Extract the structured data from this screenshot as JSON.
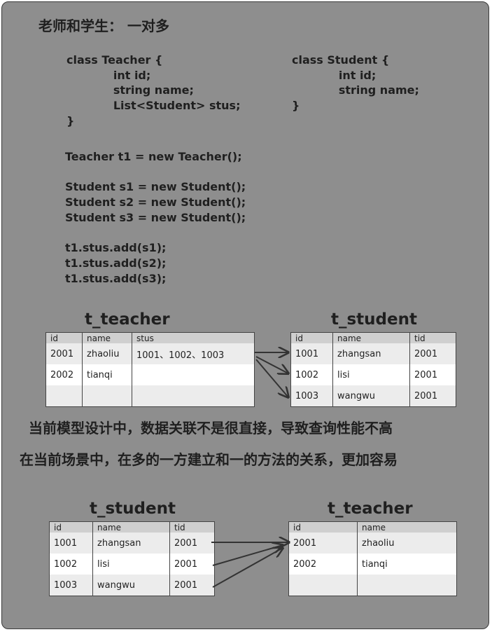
{
  "title": "老师和学生： 一对多",
  "code": {
    "teacher_class": [
      "class Teacher {",
      "            int id;",
      "            string name;",
      "            List<Student> stus;",
      "}"
    ],
    "student_class": [
      "class Student {",
      "            int id;",
      "            string name;",
      "}"
    ],
    "statements": [
      "Teacher t1 = new Teacher();",
      "",
      "Student s1 = new Student();",
      "Student s2 = new Student();",
      "Student s3 = new Student();",
      "",
      "t1.stus.add(s1);",
      "t1.stus.add(s2);",
      "t1.stus.add(s3);"
    ]
  },
  "diagram1": {
    "teacher_table": {
      "name": "t_teacher",
      "columns": [
        "id",
        "name",
        "stus"
      ],
      "rows": [
        [
          "2001",
          "zhaoliu",
          "1001、1002、1003"
        ],
        [
          "2002",
          "tianqi",
          ""
        ],
        [
          "",
          "",
          ""
        ]
      ]
    },
    "student_table": {
      "name": "t_student",
      "columns": [
        "id",
        "name",
        "tid"
      ],
      "rows": [
        [
          "1001",
          "zhangsan",
          "2001"
        ],
        [
          "1002",
          "lisi",
          "2001"
        ],
        [
          "1003",
          "wangwu",
          "2001"
        ]
      ]
    }
  },
  "notes": [
    "当前模型设计中，数据关联不是很直接，导致查询性能不高",
    "在当前场景中，在多的一方建立和一的方法的关系，更加容易"
  ],
  "diagram2": {
    "student_table": {
      "name": "t_student",
      "columns": [
        "id",
        "name",
        "tid"
      ],
      "rows": [
        [
          "1001",
          "zhangsan",
          "2001"
        ],
        [
          "1002",
          "lisi",
          "2001"
        ],
        [
          "1003",
          "wangwu",
          "2001"
        ]
      ]
    },
    "teacher_table": {
      "name": "t_teacher",
      "columns": [
        "id",
        "name"
      ],
      "rows": [
        [
          "2001",
          "zhaoliu"
        ],
        [
          "2002",
          "tianqi"
        ],
        [
          "",
          ""
        ]
      ]
    }
  },
  "colors": {
    "panel": "#8e8e8e",
    "header_row": "#cfcfcf",
    "stripe": "#ececec",
    "text": "#1f1f1f"
  }
}
